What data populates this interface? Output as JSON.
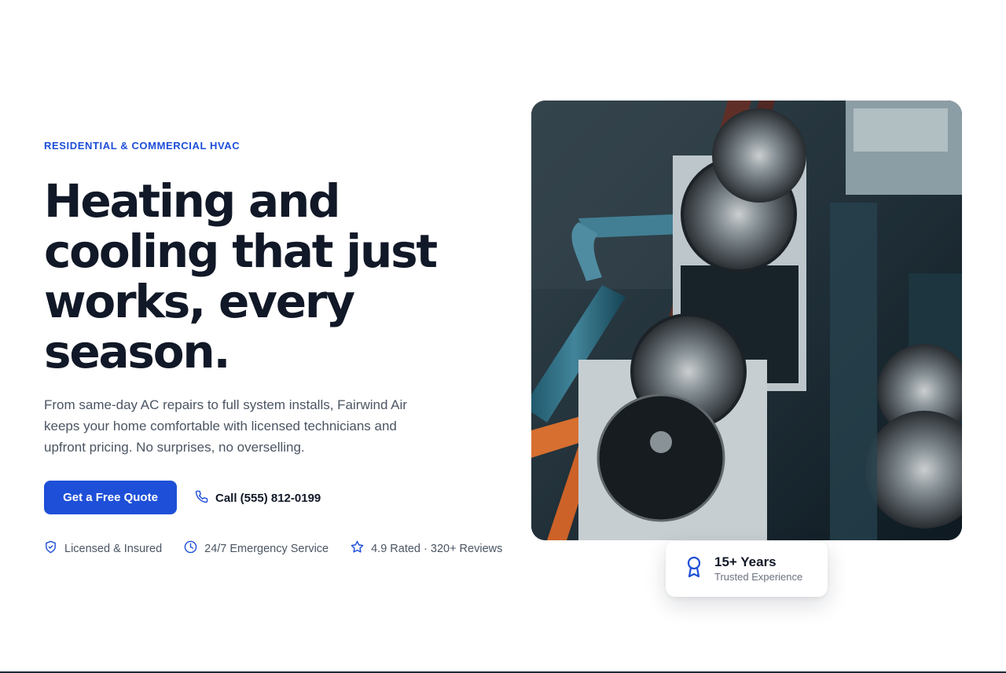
{
  "hero": {
    "eyebrow": "RESIDENTIAL & COMMERCIAL HVAC",
    "headline": "Heating and cooling that just works, every season.",
    "lead": "From same-day AC repairs to full system installs, Fairwind Air keeps your home comfortable with licensed technicians and upfront pricing. No surprises, no overselling.",
    "cta_label": "Get a Free Quote",
    "call_label": "Call (555) 812-0199",
    "badges": [
      {
        "icon": "shield-check-icon",
        "label": "Licensed & Insured"
      },
      {
        "icon": "clock-icon",
        "label": "24/7 Emergency Service"
      },
      {
        "icon": "star-icon",
        "label": "4.9 Rated · 320+ Reviews"
      }
    ]
  },
  "experience_card": {
    "icon": "award-ribbon-icon",
    "title": "15+ Years",
    "subtitle": "Trusted Experience"
  },
  "colors": {
    "accent": "#1d4ed8",
    "heading": "#111827",
    "body_text": "#4b5563"
  }
}
